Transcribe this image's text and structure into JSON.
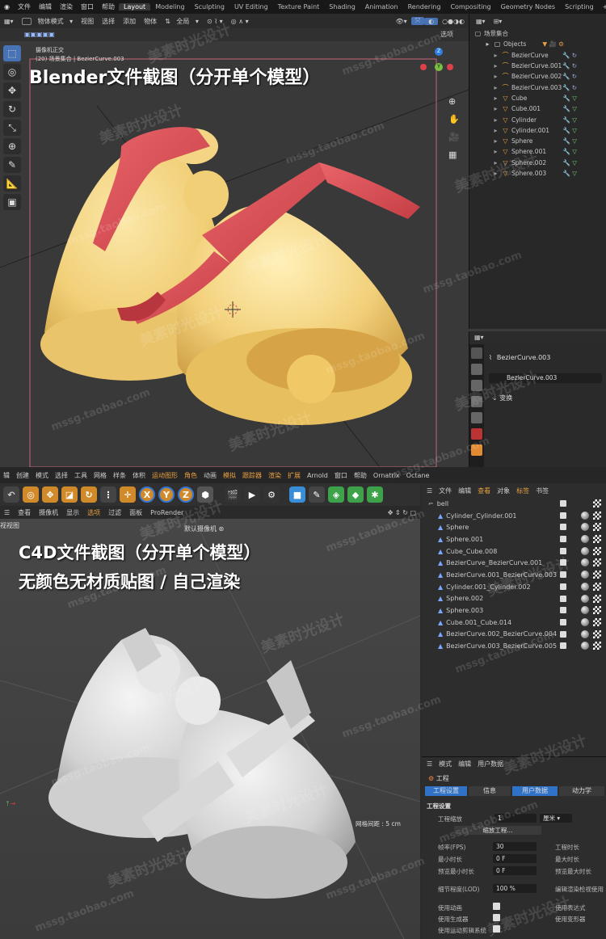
{
  "blender": {
    "menu": [
      "文件",
      "编辑",
      "渲染",
      "窗口",
      "帮助"
    ],
    "workspaces": [
      "Layout",
      "Modeling",
      "Sculpting",
      "UV Editing",
      "Texture Paint",
      "Shading",
      "Animation",
      "Rendering",
      "Compositing",
      "Geometry Nodes",
      "Scripting"
    ],
    "active_workspace": "Layout",
    "add_tab": "+",
    "header": {
      "mode": "物体模式",
      "view": "视图",
      "select": "选择",
      "add": "添加",
      "object": "物体",
      "transform": "全局",
      "options": "选项"
    },
    "viewport": {
      "camera_label": "摄像机正交",
      "collection_label": "(20) 场景集合 | BezierCurve.003",
      "axes": [
        "X",
        "Y",
        "Z"
      ]
    },
    "overlay_title": "Blender文件截图（分开单个模型）",
    "outliner": {
      "root": "场景集合",
      "collection": "Objects",
      "items": [
        "BezierCurve",
        "BezierCurve.001",
        "BezierCurve.002",
        "BezierCurve.003",
        "Cube",
        "Cube.001",
        "Cylinder",
        "Cylinder.001",
        "Sphere",
        "Sphere.001",
        "Sphere.002",
        "Sphere.003"
      ]
    },
    "properties": {
      "object_name": "BezierCurve.003",
      "data_name": "BezierCurve.003",
      "section": "变换"
    }
  },
  "c4d": {
    "menu": [
      "辑",
      "创建",
      "模式",
      "选择",
      "工具",
      "网格",
      "样条",
      "体积",
      "运动图形",
      "角色",
      "动画",
      "模拟",
      "跟踪器",
      "渲染",
      "扩展",
      "Arnold",
      "窗口",
      "帮助",
      "Ornatrix",
      "Octane"
    ],
    "tool_letters": [
      "X",
      "Y",
      "Z"
    ],
    "viewport_menu": [
      "查看",
      "摄像机",
      "显示",
      "选项",
      "过滤",
      "面板",
      "ProRender"
    ],
    "view_name": "视视图",
    "camera_name": "默认摄像机",
    "overlay_title_1": "C4D文件截图（分开单个模型）",
    "overlay_title_2": "无颜色无材质贴图 / 自己渲染",
    "grid_spacing": "网格间距 : 5 cm",
    "objects_menu": [
      "文件",
      "编辑",
      "查看",
      "对象",
      "标签",
      "书签"
    ],
    "objects_root": "bell",
    "objects": [
      "Cylinder_Cylinder.001",
      "Sphere",
      "Sphere.001",
      "Cube_Cube.008",
      "BezierCurve_BezierCurve.001",
      "BezierCurve.001_BezierCurve.003",
      "Cylinder.001_Cylinder.002",
      "Sphere.002",
      "Sphere.003",
      "Cube.001_Cube.014",
      "BezierCurve.002_BezierCurve.004",
      "BezierCurve.003_BezierCurve.005"
    ],
    "attr_menu": [
      "模式",
      "编辑",
      "用户数据"
    ],
    "attr_title": "工程",
    "attr_tabs": [
      "工程设置",
      "信息",
      "用户数据",
      "动力学"
    ],
    "section": "工程设置",
    "scale_label": "工程缩放",
    "scale_value": "1",
    "scale_unit": "厘米",
    "scale_button": "缩放工程...",
    "fps_label": "帧率(FPS)",
    "fps_value": "30",
    "min_time_label": "最小时长",
    "min_time_value": "0 F",
    "preview_min_label": "预览最小时长",
    "preview_min_value": "0 F",
    "lod_label": "细节程度(LOD)",
    "lod_value": "100 %",
    "project_time_label": "工程时长",
    "max_time_label": "最大时长",
    "preview_max_label": "预览最大时长",
    "lod_render_label": "编辑渲染检视使用",
    "use_anim": "使用动画",
    "use_gen": "使用生成器",
    "use_mograph": "使用运动剪辑系统",
    "use_expr": "使用表达式",
    "use_deform": "使用变形器"
  },
  "watermarks": [
    "美素时光设计",
    "mssg.taobao.com"
  ]
}
